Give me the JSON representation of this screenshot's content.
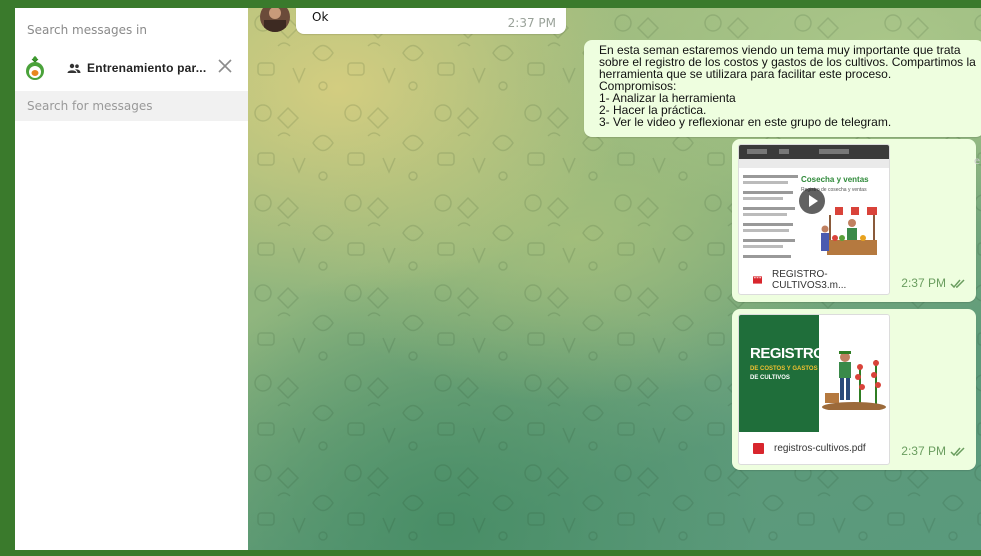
{
  "sidebar": {
    "search_in_placeholder": "Search messages in",
    "chat_name": "Entrenamiento par...",
    "search_placeholder": "Search for messages"
  },
  "chat": {
    "messages": [
      {
        "text": "Ok",
        "time": "2:37 PM"
      },
      {
        "lines": [
          "En esta seman estaremos viendo un tema muy importante que trata",
          "sobre el registro de los costos y gastos de los cultivos. Compartimos la",
          "herramienta que se utilizara para facilitar este proceso.",
          "Compromisos:",
          "1- Analizar la herramienta",
          "2- Hacer la práctica.",
          "3- Ver le video y reflexionar en este grupo de telegram."
        ]
      },
      {
        "video": {
          "thumb_title": "Cosecha y ventas",
          "thumb_subtitle": "Registro de cosecha y ventas",
          "filename": "REGISTRO-CULTIVOS3.m...",
          "time": "2:37 PM"
        }
      },
      {
        "pdf": {
          "cover_title": "REGISTRO",
          "cover_sub1": "DE COSTOS Y GASTOS",
          "cover_sub2": "DE CULTIVOS",
          "filename": "registros-cultivos.pdf",
          "badge": "PDF",
          "time": "2:37 PM"
        }
      }
    ],
    "edge_char": "e"
  },
  "colors": {
    "frame": "#3a7a2c",
    "bubble_out": "#eefedf",
    "time_green": "#6a9d5f",
    "cover_green": "#1f6e3a",
    "file_red": "#d8262d"
  },
  "icons": [
    "group-icon",
    "close-icon",
    "play-icon",
    "video-file-icon",
    "pdf-file-icon",
    "double-check-icon"
  ]
}
